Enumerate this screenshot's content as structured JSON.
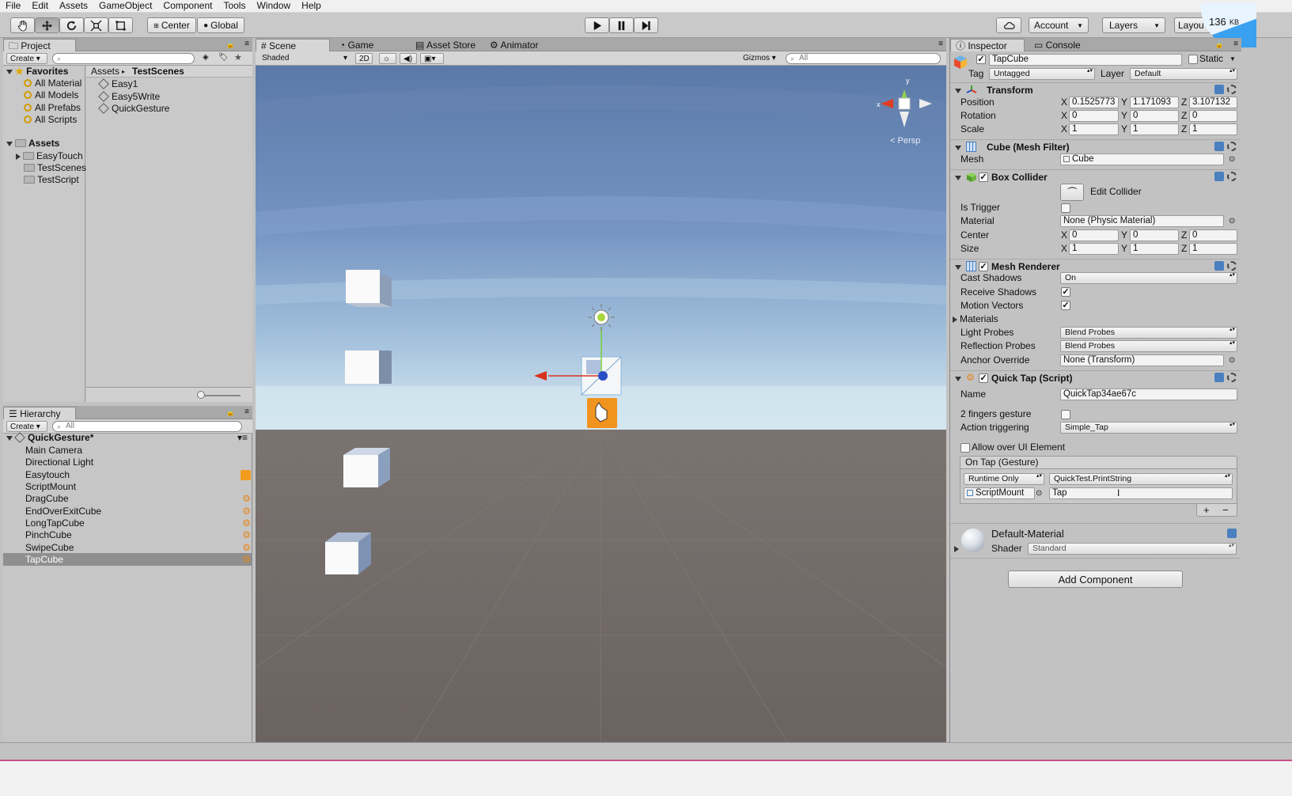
{
  "menu": [
    "File",
    "Edit",
    "Assets",
    "GameObject",
    "Component",
    "Tools",
    "Window",
    "Help"
  ],
  "toolbar": {
    "pivot": "Center",
    "space": "Global",
    "account": "Account",
    "layers": "Layers",
    "layout": "Layou",
    "net_speed": "136",
    "net_unit": "KB"
  },
  "project": {
    "tab": "Project",
    "create": "Create",
    "favorites_label": "Favorites",
    "favorites": [
      "All Material",
      "All Models",
      "All Prefabs",
      "All Scripts"
    ],
    "assets_label": "Assets",
    "assets": [
      "EasyTouch",
      "TestScenes",
      "TestScript"
    ],
    "breadcrumb": [
      "Assets",
      "TestScenes"
    ],
    "files": [
      "Easy1",
      "Easy5Write",
      "QuickGesture"
    ]
  },
  "hierarchy": {
    "tab": "Hierarchy",
    "create": "Create",
    "search_placeholder": "All",
    "scene": "QuickGesture*",
    "items": [
      "Main Camera",
      "Directional Light",
      "Easytouch",
      "ScriptMount",
      "DragCube",
      "EndOverExitCube",
      "LongTapCube",
      "PinchCube",
      "SwipeCube",
      "TapCube"
    ],
    "selected": "TapCube"
  },
  "scene": {
    "tabs": [
      "Scene",
      "Game",
      "Asset Store",
      "Animator"
    ],
    "shading": "Shaded",
    "mode2d": "2D",
    "gizmos": "Gizmos",
    "search_placeholder": "All",
    "persp": "Persp",
    "gizmo_y": "y",
    "gizmo_x": "x"
  },
  "inspector": {
    "tabs": [
      "Inspector",
      "Console"
    ],
    "object_name": "TapCube",
    "static": "Static",
    "tag_label": "Tag",
    "tag": "Untagged",
    "layer_label": "Layer",
    "layer": "Default",
    "transform": {
      "title": "Transform",
      "position_label": "Position",
      "rotation_label": "Rotation",
      "scale_label": "Scale",
      "position": [
        "0.1525773",
        "1.171093",
        "3.107132"
      ],
      "rotation": [
        "0",
        "0",
        "0"
      ],
      "scale": [
        "1",
        "1",
        "1"
      ]
    },
    "mesh_filter": {
      "title": "Cube (Mesh Filter)",
      "mesh_label": "Mesh",
      "mesh": "Cube"
    },
    "box_collider": {
      "title": "Box Collider",
      "edit": "Edit Collider",
      "is_trigger_label": "Is Trigger",
      "material_label": "Material",
      "material": "None (Physic Material)",
      "center_label": "Center",
      "size_label": "Size",
      "center": [
        "0",
        "0",
        "0"
      ],
      "size": [
        "1",
        "1",
        "1"
      ]
    },
    "mesh_renderer": {
      "title": "Mesh Renderer",
      "cast_shadows_label": "Cast Shadows",
      "cast_shadows": "On",
      "receive_shadows_label": "Receive Shadows",
      "motion_vectors_label": "Motion Vectors",
      "materials_label": "Materials",
      "light_probes_label": "Light Probes",
      "light_probes": "Blend Probes",
      "reflection_probes_label": "Reflection Probes",
      "reflection_probes": "Blend Probes",
      "anchor_label": "Anchor Override",
      "anchor": "None (Transform)"
    },
    "quick_tap": {
      "title": "Quick Tap (Script)",
      "name_label": "Name",
      "name": "QuickTap34ae67c",
      "two_fingers_label": "2 fingers gesture",
      "action_label": "Action triggering",
      "action": "Simple_Tap",
      "allow_ui": "Allow over UI Element",
      "event_title": "On Tap (Gesture)",
      "runtime": "Runtime Only",
      "function": "QuickTest.PrintString",
      "object": "ScriptMount",
      "argument": "Tap",
      "plus": "+",
      "minus": "−"
    },
    "material": {
      "name": "Default-Material",
      "shader_label": "Shader",
      "shader": "Standard"
    },
    "add_component": "Add Component"
  }
}
